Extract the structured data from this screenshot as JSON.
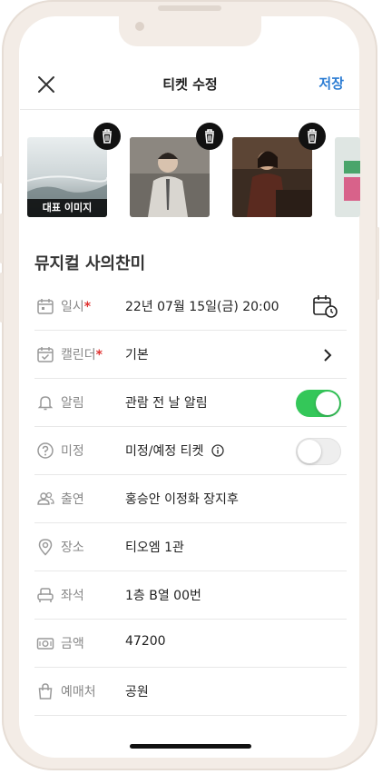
{
  "header": {
    "title": "티켓 수정",
    "save_label": "저장"
  },
  "thumbnails": {
    "representative_label": "대표 이미지"
  },
  "concert_title": "뮤지컬 사의찬미",
  "fields": {
    "datetime": {
      "label": "일시",
      "required_mark": "*",
      "value": "22년 07월 15일(금) 20:00"
    },
    "calendar": {
      "label": "캘린더",
      "required_mark": "*",
      "value": "기본"
    },
    "alarm": {
      "label": "알림",
      "value": "관람 전 날 알림",
      "enabled": true
    },
    "undecided": {
      "label": "미정",
      "value": "미정/예정 티켓",
      "enabled": false
    },
    "cast": {
      "label": "출연",
      "value": "홍승안 이정화 장지후"
    },
    "venue": {
      "label": "장소",
      "value": "티오엠 1관"
    },
    "seat": {
      "label": "좌석",
      "value": "1층 B열 00번"
    },
    "price": {
      "label": "금액",
      "value": "47200"
    },
    "booking": {
      "label": "예매처",
      "value": "공원"
    }
  },
  "colors": {
    "accent": "#2b7cd3",
    "toggle_on": "#34c759",
    "required": "#e0312f"
  }
}
